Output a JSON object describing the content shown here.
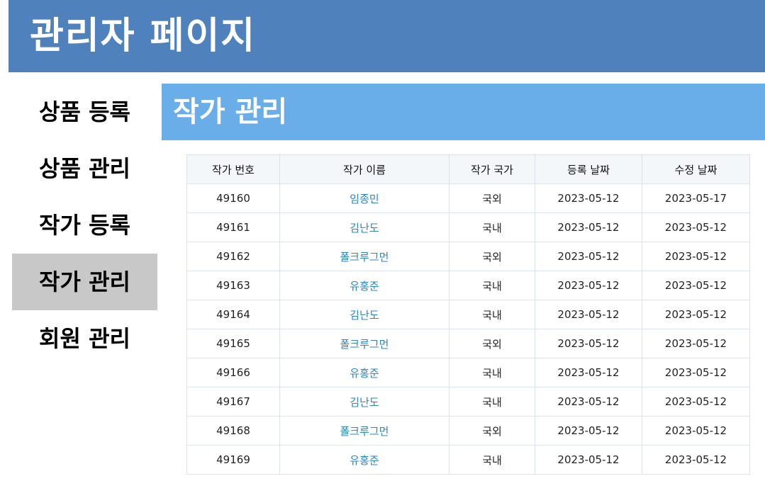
{
  "header": {
    "title": "관리자 페이지"
  },
  "sidebar": {
    "items": [
      {
        "label": "상품 등록",
        "active": false
      },
      {
        "label": "상품 관리",
        "active": false
      },
      {
        "label": "작가 등록",
        "active": false
      },
      {
        "label": "작가 관리",
        "active": true
      },
      {
        "label": "회원 관리",
        "active": false
      }
    ]
  },
  "section": {
    "title": "작가 관리"
  },
  "table": {
    "columns": [
      "작가 번호",
      "작가 이름",
      "작가 국가",
      "등록 날짜",
      "수정 날짜"
    ],
    "rows": [
      [
        "49160",
        "임종민",
        "국외",
        "2023-05-12",
        "2023-05-17"
      ],
      [
        "49161",
        "김난도",
        "국내",
        "2023-05-12",
        "2023-05-12"
      ],
      [
        "49162",
        "폴크루그먼",
        "국외",
        "2023-05-12",
        "2023-05-12"
      ],
      [
        "49163",
        "유홍준",
        "국내",
        "2023-05-12",
        "2023-05-12"
      ],
      [
        "49164",
        "김난도",
        "국내",
        "2023-05-12",
        "2023-05-12"
      ],
      [
        "49165",
        "폴크루그먼",
        "국외",
        "2023-05-12",
        "2023-05-12"
      ],
      [
        "49166",
        "유홍준",
        "국내",
        "2023-05-12",
        "2023-05-12"
      ],
      [
        "49167",
        "김난도",
        "국내",
        "2023-05-12",
        "2023-05-12"
      ],
      [
        "49168",
        "폴크루그먼",
        "국외",
        "2023-05-12",
        "2023-05-12"
      ],
      [
        "49169",
        "유홍준",
        "국내",
        "2023-05-12",
        "2023-05-12"
      ]
    ]
  },
  "colors": {
    "header_bg": "#4f81bd",
    "section_bg": "#69aee8",
    "active_item_bg": "#c8c8c8",
    "link": "#2e86c1"
  }
}
